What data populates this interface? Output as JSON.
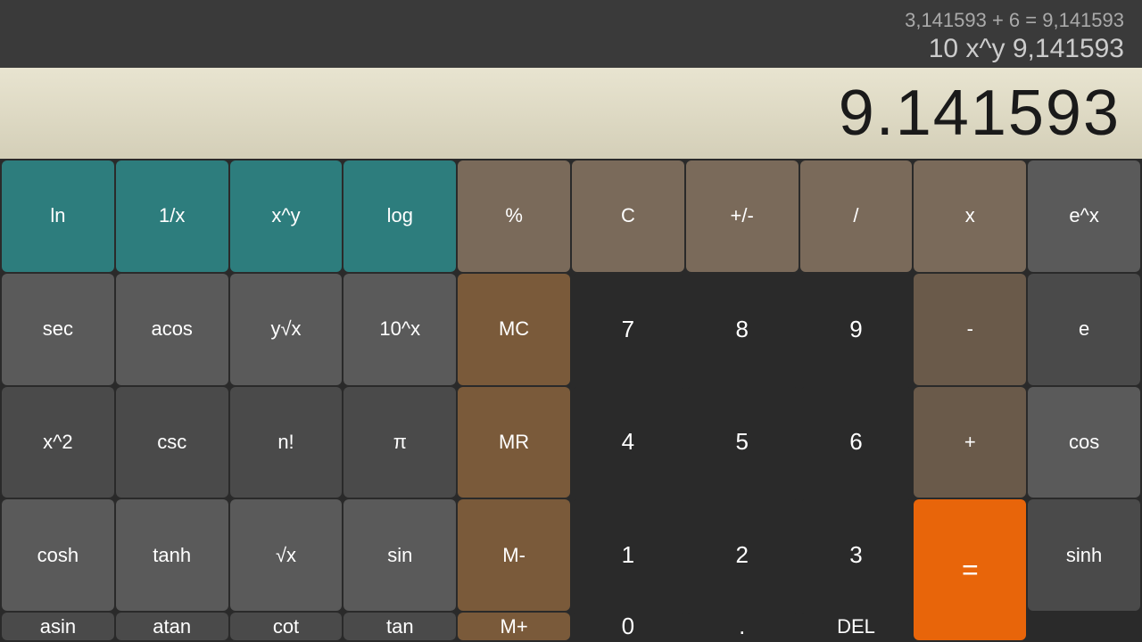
{
  "history": {
    "line1": "3,141593 + 6 = 9,141593",
    "line2": "10 x^y 9,141593"
  },
  "display": {
    "value": "9.141593"
  },
  "buttons": {
    "row1": [
      {
        "label": "ln",
        "type": "teal",
        "name": "ln-button"
      },
      {
        "label": "1/x",
        "type": "teal",
        "name": "reciprocal-button"
      },
      {
        "label": "x^y",
        "type": "teal",
        "name": "xpowy-button"
      },
      {
        "label": "log",
        "type": "teal",
        "name": "log-button"
      },
      {
        "label": "%",
        "type": "brown",
        "name": "percent-button"
      },
      {
        "label": "C",
        "type": "brown",
        "name": "clear-button"
      },
      {
        "label": "+/-",
        "type": "brown",
        "name": "negate-button"
      },
      {
        "label": "/",
        "type": "brown",
        "name": "divide-button"
      },
      {
        "label": "x",
        "type": "brown",
        "name": "multiply-button"
      }
    ],
    "row2": [
      {
        "label": "e^x",
        "type": "gray",
        "name": "epowx-button"
      },
      {
        "label": "sec",
        "type": "gray",
        "name": "sec-button"
      },
      {
        "label": "acos",
        "type": "gray",
        "name": "acos-button"
      },
      {
        "label": "y√x",
        "type": "gray",
        "name": "yroot-button"
      },
      {
        "label": "10^x",
        "type": "gray",
        "name": "tenpowx-button"
      },
      {
        "label": "MC",
        "type": "memory",
        "name": "mc-button"
      },
      {
        "label": "7",
        "type": "num",
        "name": "7-button"
      },
      {
        "label": "8",
        "type": "num",
        "name": "8-button"
      },
      {
        "label": "9",
        "type": "num",
        "name": "9-button"
      },
      {
        "label": "-",
        "type": "darkbrown",
        "name": "subtract-button"
      }
    ],
    "row3": [
      {
        "label": "e",
        "type": "gray",
        "name": "e-button"
      },
      {
        "label": "x^2",
        "type": "gray",
        "name": "xsq-button"
      },
      {
        "label": "csc",
        "type": "gray",
        "name": "csc-button"
      },
      {
        "label": "n!",
        "type": "gray",
        "name": "factorial-button"
      },
      {
        "label": "π",
        "type": "gray",
        "name": "pi-button"
      },
      {
        "label": "MR",
        "type": "memory",
        "name": "mr-button"
      },
      {
        "label": "4",
        "type": "num",
        "name": "4-button"
      },
      {
        "label": "5",
        "type": "num",
        "name": "5-button"
      },
      {
        "label": "6",
        "type": "num",
        "name": "6-button"
      },
      {
        "label": "+",
        "type": "darkbrown",
        "name": "add-button"
      }
    ],
    "row4": [
      {
        "label": "cos",
        "type": "gray",
        "name": "cos-button"
      },
      {
        "label": "cosh",
        "type": "gray",
        "name": "cosh-button"
      },
      {
        "label": "tanh",
        "type": "gray",
        "name": "tanh-button"
      },
      {
        "label": "√x",
        "type": "gray",
        "name": "sqrt-button"
      },
      {
        "label": "sin",
        "type": "gray",
        "name": "sin-button"
      },
      {
        "label": "M-",
        "type": "memory",
        "name": "mminus-button"
      },
      {
        "label": "1",
        "type": "num",
        "name": "1-button"
      },
      {
        "label": "2",
        "type": "num",
        "name": "2-button"
      },
      {
        "label": "3",
        "type": "num",
        "name": "3-button"
      },
      {
        "label": "=",
        "type": "equals",
        "name": "equals-button"
      }
    ],
    "row5": [
      {
        "label": "sinh",
        "type": "gray",
        "name": "sinh-button"
      },
      {
        "label": "asin",
        "type": "gray",
        "name": "asin-button"
      },
      {
        "label": "atan",
        "type": "gray",
        "name": "atan-button"
      },
      {
        "label": "cot",
        "type": "gray",
        "name": "cot-button"
      },
      {
        "label": "tan",
        "type": "gray",
        "name": "tan-button"
      },
      {
        "label": "M+",
        "type": "memory",
        "name": "mplus-button"
      },
      {
        "label": "0",
        "type": "num",
        "name": "0-button"
      },
      {
        "label": ".",
        "type": "num",
        "name": "decimal-button"
      },
      {
        "label": "DEL",
        "type": "del",
        "name": "del-button"
      }
    ]
  }
}
